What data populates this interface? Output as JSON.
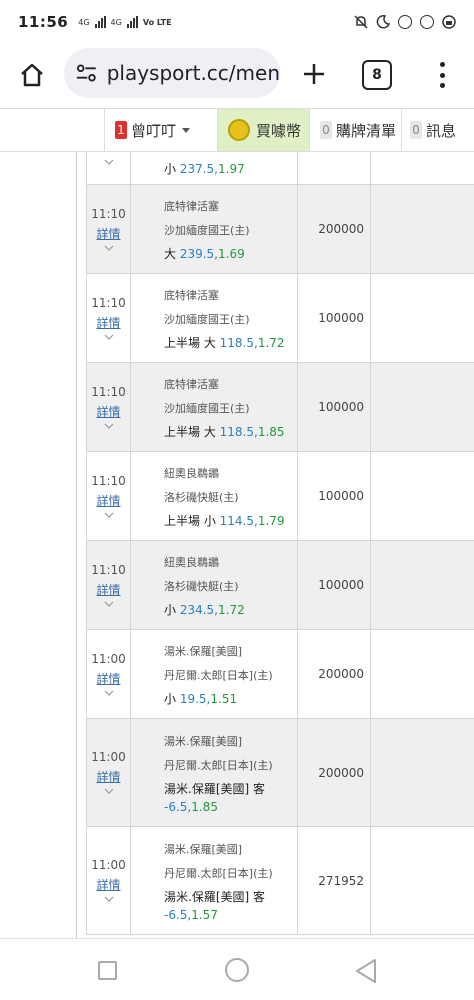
{
  "status": {
    "time": "11:56",
    "net1": "4G",
    "net2": "4G",
    "volte": "Vo LTE"
  },
  "browser": {
    "url": "playsport.cc/men",
    "tab_count": "8"
  },
  "site_nav": {
    "user_count": "1",
    "user_name": "曾叮叮",
    "coins_label": "買噱幣",
    "cart_count": "0",
    "cart_label": "購牌清單",
    "msg_count": "0",
    "msg_label": "訊息"
  },
  "rows": [
    {
      "time": "",
      "detail": "",
      "team1": "",
      "team2": "",
      "pick_prefix": "小 ",
      "pick_line": "237.5,",
      "pick_odds": "1.97",
      "amount": "",
      "alt": false,
      "partial": true
    },
    {
      "time": "11:10",
      "detail": "詳情",
      "team1": "底特律活塞",
      "team2": "沙加緬度國王(主)",
      "pick_prefix": "大 ",
      "pick_line": "239.5,",
      "pick_odds": "1.69",
      "amount": "200000",
      "alt": true
    },
    {
      "time": "11:10",
      "detail": "詳情",
      "team1": "底特律活塞",
      "team2": "沙加緬度國王(主)",
      "pick_prefix": "上半場 大 ",
      "pick_line": "118.5,",
      "pick_odds": "1.72",
      "amount": "100000",
      "alt": false
    },
    {
      "time": "11:10",
      "detail": "詳情",
      "team1": "底特律活塞",
      "team2": "沙加緬度國王(主)",
      "pick_prefix": "上半場 大 ",
      "pick_line": "118.5,",
      "pick_odds": "1.85",
      "amount": "100000",
      "alt": true
    },
    {
      "time": "11:10",
      "detail": "詳情",
      "team1": "紐奧良鵜鶘",
      "team2": "洛杉磯快艇(主)",
      "pick_prefix": "上半場 小 ",
      "pick_line": "114.5,",
      "pick_odds": "1.79",
      "amount": "100000",
      "alt": false
    },
    {
      "time": "11:10",
      "detail": "詳情",
      "team1": "紐奧良鵜鶘",
      "team2": "洛杉磯快艇(主)",
      "pick_prefix": "小 ",
      "pick_line": "234.5,",
      "pick_odds": "1.72",
      "amount": "100000",
      "alt": true
    },
    {
      "time": "11:00",
      "detail": "詳情",
      "team1": "湯米.保羅[美國]",
      "team2": "丹尼爾.太郎[日本](主)",
      "pick_prefix": "小 ",
      "pick_line": "19.5,",
      "pick_odds": "1.51",
      "amount": "200000",
      "alt": false
    },
    {
      "time": "11:00",
      "detail": "詳情",
      "team1": "湯米.保羅[美國]",
      "team2": "丹尼爾.太郎[日本](主)",
      "pick_prefix": "湯米.保羅[美國] 客 ",
      "pick_line": "-6.5,",
      "pick_odds": "1.85",
      "amount": "200000",
      "alt": true
    },
    {
      "time": "11:00",
      "detail": "詳情",
      "team1": "湯米.保羅[美國]",
      "team2": "丹尼爾.太郎[日本](主)",
      "pick_prefix": "湯米.保羅[美國] 客 ",
      "pick_line": "-6.5,",
      "pick_odds": "1.57",
      "amount": "271952",
      "alt": false
    }
  ]
}
